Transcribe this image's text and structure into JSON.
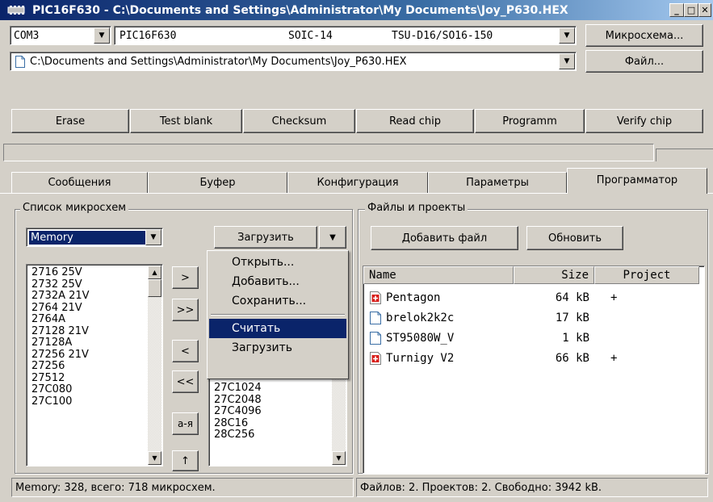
{
  "window": {
    "title": "PIC16F630 - C:\\Documents and Settings\\Administrator\\My Documents\\Joy_P630.HEX",
    "icon": "programmer-device-icon"
  },
  "toolbar": {
    "port": "COM3",
    "chip": "PIC16F630",
    "package": "SOIC-14",
    "adapter": "TSU-D16/SO16-150",
    "chip_button": "Микросхема...",
    "file_path": "C:\\Documents and Settings\\Administrator\\My Documents\\Joy_P630.HEX",
    "file_button": "Файл..."
  },
  "actions": {
    "erase": "Erase",
    "test_blank": "Test blank",
    "checksum": "Checksum",
    "read_chip": "Read chip",
    "program": "Programm",
    "verify": "Verify chip"
  },
  "tabs": [
    "Сообщения",
    "Буфер",
    "Конфигурация",
    "Параметры",
    "Программатор"
  ],
  "active_tab": "Программатор",
  "chip_list": {
    "title": "Список микросхем",
    "filter": "Memory",
    "load_button": "Загрузить",
    "items": [
      "2716  25V",
      "2732  25V",
      "2732A 21V",
      "2764  21V",
      "2764A",
      "27128 21V",
      "27128A",
      "27256 21V",
      "27256",
      "27512",
      "27C080",
      "27C100"
    ],
    "selected_items": [
      "27C1024",
      "27C2048",
      "27C4096",
      "28C16",
      "28C256"
    ],
    "move_buttons": [
      ">",
      ">>",
      "<",
      "<<",
      "а-я",
      "↑"
    ]
  },
  "menu": {
    "items": [
      "Открыть...",
      "Добавить...",
      "Сохранить...",
      "Считать",
      "Загрузить"
    ],
    "highlighted": "Считать"
  },
  "files": {
    "title": "Файлы и проекты",
    "add_button": "Добавить файл",
    "refresh_button": "Обновить",
    "columns": [
      "Name",
      "Size",
      "Project"
    ],
    "rows": [
      {
        "name": "Pentagon",
        "size": "64 kB",
        "project": "+",
        "icon": "project-file-icon"
      },
      {
        "name": "brelok2k2c",
        "size": "17 kB",
        "project": "",
        "icon": "document-icon"
      },
      {
        "name": "ST95080W_V",
        "size": "1 kB",
        "project": "",
        "icon": "document-icon"
      },
      {
        "name": "Turnigy V2",
        "size": "66 kB",
        "project": "+",
        "icon": "project-file-icon"
      }
    ]
  },
  "status": {
    "left": "Memory: 328,  всего: 718  микросхем.",
    "right": "Файлов: 2. Проектов: 2. Свободно: 3942 kB."
  }
}
